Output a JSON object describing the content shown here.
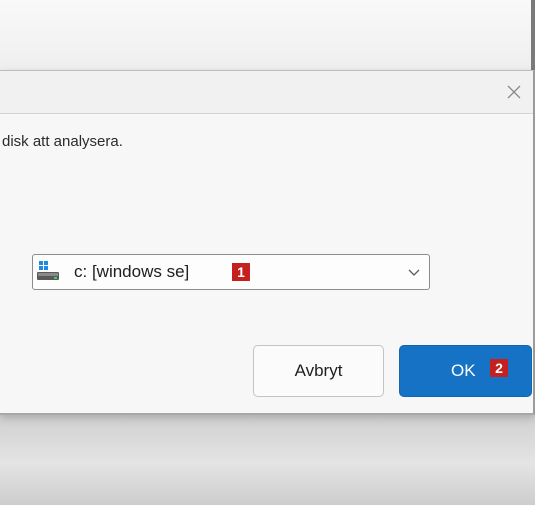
{
  "dialog": {
    "close_icon": "close-icon",
    "instruction": "disk att analysera.",
    "drive_select": {
      "selected": "c: [windows se]",
      "icon": "drive-icon"
    },
    "badges": {
      "drive_select": "1",
      "ok_button": "2"
    },
    "buttons": {
      "cancel_label": "Avbryt",
      "ok_label": "OK"
    }
  },
  "colors": {
    "accent": "#1672c5",
    "badge": "#c4201f",
    "dialog_bg": "#f6f6f6"
  }
}
